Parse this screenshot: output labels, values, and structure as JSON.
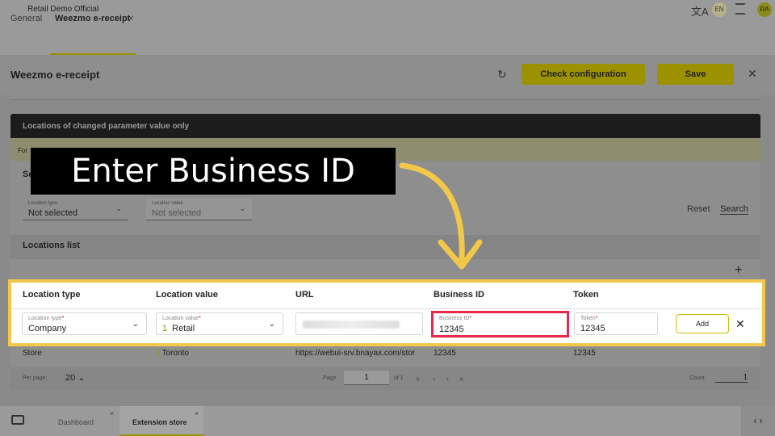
{
  "app": {
    "title": "Retail Demo Official",
    "lang_badge": "EN",
    "user_initials": "RA"
  },
  "tabs": [
    {
      "label": "General"
    },
    {
      "label": "Weezmo e-receipt"
    }
  ],
  "tab_close": "×",
  "page": {
    "title": "Weezmo e-receipt",
    "check_config_label": "Check configuration",
    "save_label": "Save"
  },
  "section": {
    "header": "Locations of changed parameter value only",
    "note": "For",
    "search_header": "Se",
    "filters": {
      "location_type": {
        "label": "Location type",
        "value": "Not selected"
      },
      "location_value": {
        "label": "Location value",
        "value": "Not selected"
      }
    },
    "reset_label": "Reset",
    "search_label": "Search"
  },
  "locations_list": {
    "title": "Locations list",
    "columns": [
      "Location type",
      "Location value",
      "URL",
      "Business ID",
      "Token"
    ],
    "new_row": {
      "location_type": {
        "label": "Location type",
        "value": "Company"
      },
      "location_value": {
        "label": "Location value",
        "num": "1",
        "value": "Retail"
      },
      "business_id": {
        "label": "Business ID",
        "value": "12345"
      },
      "token": {
        "label": "Token",
        "value": "12345"
      },
      "add_label": "Add"
    },
    "rows": [
      {
        "location_type": "Store",
        "num": "1",
        "location_value": "Toronto",
        "url": "https://webui-srv.bnayax.com/stor",
        "business_id": "12345",
        "token": "12345"
      }
    ]
  },
  "pagination": {
    "per_page_label": "Per page:",
    "per_page": "20",
    "page_label": "Page",
    "page": "1",
    "of": "of 1",
    "count_label": "Count",
    "count": "1"
  },
  "taskbar": {
    "tabs": [
      {
        "label": "Dashboard"
      },
      {
        "label": "Extension store"
      }
    ]
  },
  "annotation": {
    "text": "Enter Business ID",
    "accent": "#f2c84a",
    "highlight": "#e8274b"
  }
}
